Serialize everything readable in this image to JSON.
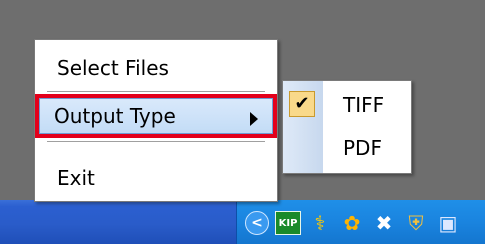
{
  "context_menu": {
    "items": [
      {
        "label": "Select Files"
      },
      {
        "label": "Output Type"
      },
      {
        "label": "Exit"
      }
    ]
  },
  "output_type_submenu": {
    "items": [
      {
        "label": "TIFF",
        "checked": true
      },
      {
        "label": "PDF",
        "checked": false
      }
    ]
  },
  "tray": {
    "chevron": "<",
    "kip_label": "KIP",
    "icons": [
      "show-hidden-icons-icon",
      "kip-icon",
      "user-figure-icon",
      "flower-icon",
      "network-x-icon",
      "shield-icon",
      "monitor-icon"
    ]
  },
  "colors": {
    "highlight_border": "#e3001b",
    "taskbar": "#2a5cc9",
    "tray": "#1a84df",
    "check_bg": "#f9d98a"
  }
}
